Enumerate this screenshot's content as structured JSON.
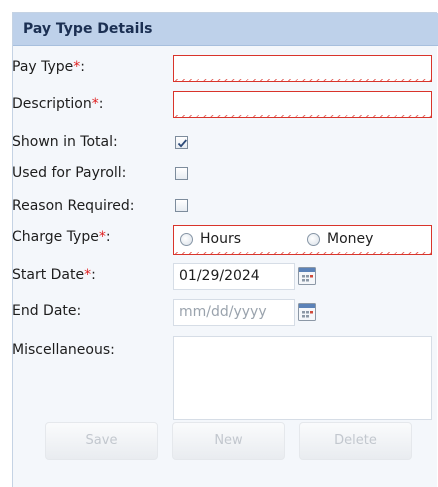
{
  "header": {
    "title": "Pay Type Details"
  },
  "form": {
    "pay_type": {
      "label": "Pay Type",
      "required_mark": "*",
      "suffix": ":",
      "value": ""
    },
    "description": {
      "label": "Description",
      "required_mark": "*",
      "suffix": ":",
      "value": ""
    },
    "shown_in_total": {
      "label": "Shown in Total:",
      "checked": true
    },
    "used_for_payroll": {
      "label": "Used for Payroll:",
      "checked": false
    },
    "reason_required": {
      "label": "Reason Required:",
      "checked": false
    },
    "charge_type": {
      "label": "Charge Type",
      "required_mark": "*",
      "suffix": ":",
      "options": [
        "Hours",
        "Money"
      ],
      "selected": null
    },
    "start_date": {
      "label": "Start Date",
      "required_mark": "*",
      "suffix": ":",
      "value": "01/29/2024"
    },
    "end_date": {
      "label": "End Date:",
      "placeholder": "mm/dd/yyyy",
      "value": ""
    },
    "miscellaneous": {
      "label": "Miscellaneous:",
      "value": ""
    }
  },
  "buttons": {
    "save": "Save",
    "new": "New",
    "delete": "Delete"
  },
  "colors": {
    "header_bg": "#bed1ea",
    "panel_bg": "#f4f7fb",
    "required": "#e02020",
    "invalid_border": "#d9342b",
    "disabled_text": "#c2c7ce"
  },
  "icons": {
    "calendar": "calendar-icon",
    "checkmark": "checkmark-icon",
    "radio": "radio-icon"
  }
}
